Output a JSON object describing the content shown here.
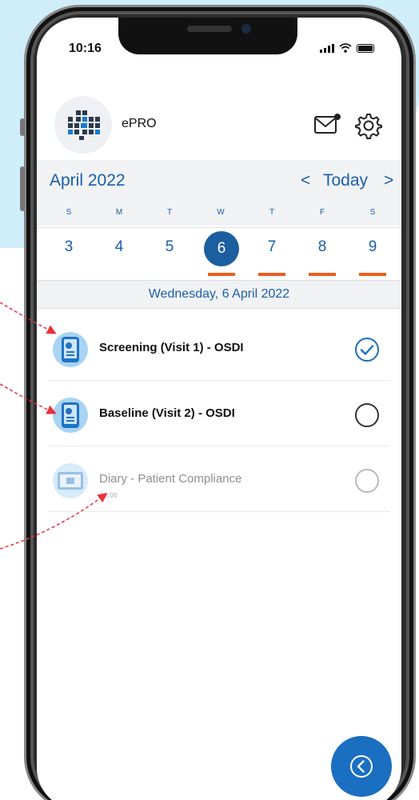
{
  "status": {
    "time": "10:16"
  },
  "header": {
    "app_name": "ePRO"
  },
  "calendar": {
    "month": "April 2022",
    "prev_label": "<",
    "today_label": "Today",
    "next_label": ">",
    "weekdays": [
      "S",
      "M",
      "T",
      "W",
      "T",
      "F",
      "S"
    ],
    "dates": [
      "3",
      "4",
      "5",
      "6",
      "7",
      "8",
      "9"
    ],
    "selected_index": 3,
    "marked_days": [
      "6",
      "7",
      "8",
      "9"
    ],
    "selected_day_label": "Wednesday, 6 April 2022"
  },
  "tasks": [
    {
      "title": "Screening (Visit 1) - OSDI",
      "subtitle": "",
      "status": "completed"
    },
    {
      "title": "Baseline (Visit 2) - OSDI",
      "subtitle": "",
      "status": "open"
    },
    {
      "title": "Diary - Patient Compliance",
      "subtitle": "21:00",
      "status": "disabled"
    }
  ],
  "colors": {
    "brand_blue": "#1a5fa8",
    "selected_day": "#1b5fa0",
    "marker_orange": "#ea5d1e",
    "fab_blue": "#1a6fc0",
    "annotation_red": "#e8323c"
  }
}
